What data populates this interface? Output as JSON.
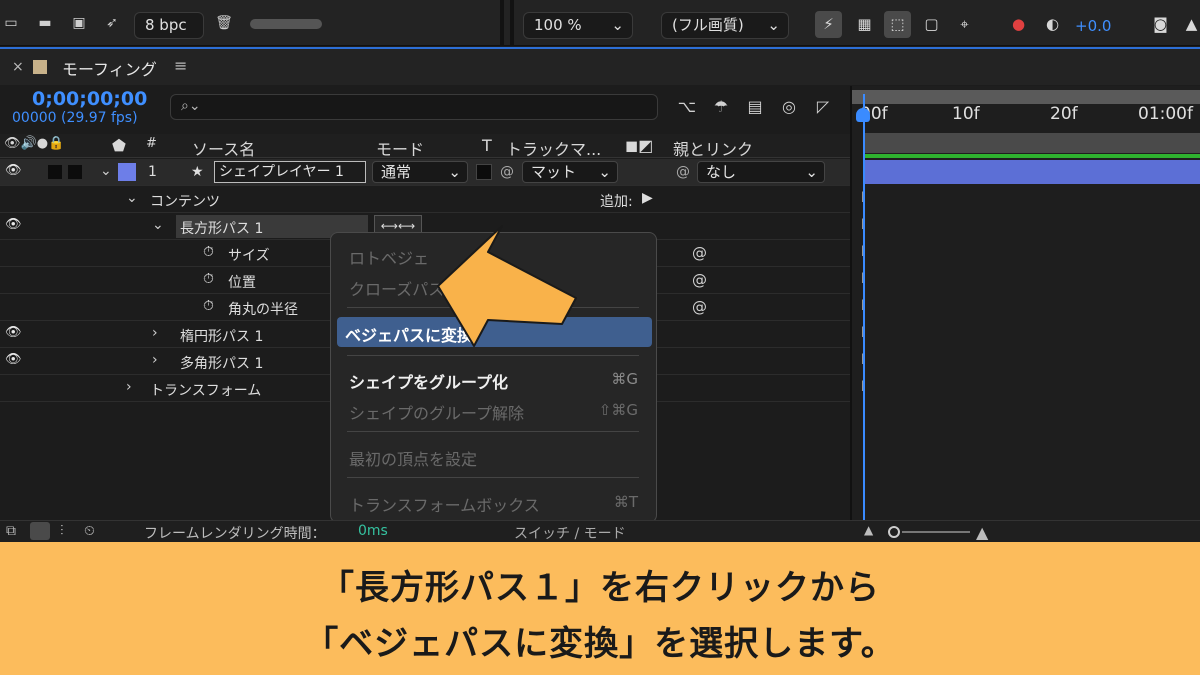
{
  "toolbar": {
    "bpc": "8 bpc",
    "zoom": "100 %",
    "quality": "(フル画質)",
    "exposure": "+0.0"
  },
  "panel": {
    "title": "モーフィング"
  },
  "time": {
    "timecode": "0;00;00;00",
    "frames": "00000 (29.97 fps)"
  },
  "columns": {
    "source": "ソース名",
    "mode": "モード",
    "t": "T",
    "track": "トラックマ...",
    "parent": "親とリンク",
    "num": "#"
  },
  "layer": {
    "index": "1",
    "name": "シェイプレイヤー 1",
    "mode": "通常",
    "matte": "マット",
    "parent": "なし"
  },
  "tree": {
    "contents": "コンテンツ",
    "add": "追加:",
    "rect_path": "長方形パス 1",
    "size": "サイズ",
    "position": "位置",
    "roundness": "角丸の半径",
    "ellipse_path": "楕円形パス 1",
    "polygon_path": "多角形パス 1",
    "transform": "トランスフォーム"
  },
  "timeline": {
    "ticks": [
      "00f",
      "10f",
      "20f",
      "01:00f"
    ]
  },
  "context_menu": {
    "rotobezier": "ロトベジェ",
    "closed_path": "クローズパス",
    "convert_bezier": "ベジェパスに変換",
    "group_shapes": "シェイプをグループ化",
    "group_shortcut": "⌘G",
    "ungroup_shapes": "シェイプのグループ解除",
    "ungroup_shortcut": "⇧⌘G",
    "set_first_vertex": "最初の頂点を設定",
    "transform_box": "トランスフォームボックス",
    "transform_shortcut": "⌘T"
  },
  "status": {
    "render_label": "フレームレンダリング時間：",
    "render_value": "0ms",
    "switches": "スイッチ / モード"
  },
  "banner": {
    "line1": "「長方形パス１」を右クリックから",
    "line2": "「ベジェパスに変換」を選択します。"
  },
  "colors": {
    "accent_blue": "#3a8bff",
    "banner_orange": "#fcbc5c",
    "arrow_orange": "#f9b24a",
    "layer_label": "#5c6fd6",
    "menu_highlight": "#3f5f8f"
  }
}
